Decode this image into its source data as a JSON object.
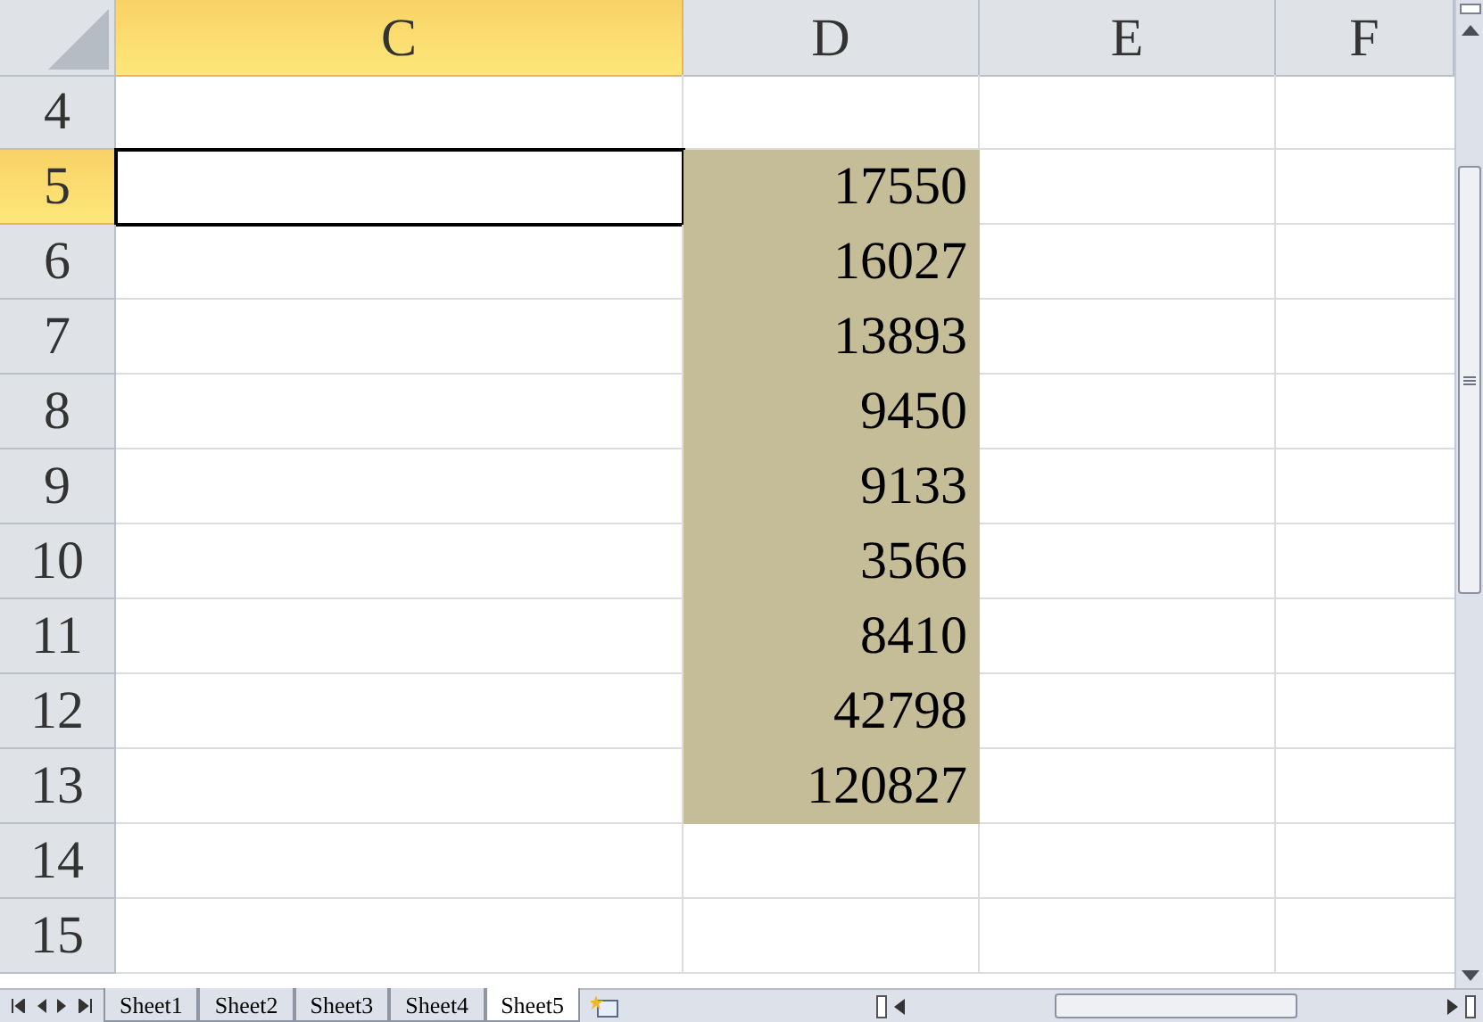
{
  "columns": [
    {
      "label": "C",
      "selected": true
    },
    {
      "label": "D",
      "selected": false
    },
    {
      "label": "E",
      "selected": false
    },
    {
      "label": "F",
      "selected": false
    }
  ],
  "rows": [
    {
      "label": "4",
      "selected": false,
      "cells": [
        {
          "filled": false,
          "active": false
        },
        {
          "filled": false,
          "active": false
        }
      ]
    },
    {
      "label": "5",
      "selected": true,
      "cells": [
        {
          "filled": false,
          "active": true
        },
        {
          "value": "17550",
          "filled": true,
          "active": false
        }
      ]
    },
    {
      "label": "6",
      "selected": false,
      "cells": [
        {
          "filled": false,
          "active": false
        },
        {
          "value": "16027",
          "filled": true,
          "active": false
        }
      ]
    },
    {
      "label": "7",
      "selected": false,
      "cells": [
        {
          "filled": false,
          "active": false
        },
        {
          "value": "13893",
          "filled": true,
          "active": false
        }
      ]
    },
    {
      "label": "8",
      "selected": false,
      "cells": [
        {
          "filled": false,
          "active": false
        },
        {
          "value": "9450",
          "filled": true,
          "active": false
        }
      ]
    },
    {
      "label": "9",
      "selected": false,
      "cells": [
        {
          "filled": false,
          "active": false
        },
        {
          "value": "9133",
          "filled": true,
          "active": false
        }
      ]
    },
    {
      "label": "10",
      "selected": false,
      "cells": [
        {
          "filled": false,
          "active": false
        },
        {
          "value": "3566",
          "filled": true,
          "active": false
        }
      ]
    },
    {
      "label": "11",
      "selected": false,
      "cells": [
        {
          "filled": false,
          "active": false
        },
        {
          "value": "8410",
          "filled": true,
          "active": false
        }
      ]
    },
    {
      "label": "12",
      "selected": false,
      "cells": [
        {
          "filled": false,
          "active": false
        },
        {
          "value": "42798",
          "filled": true,
          "active": false
        }
      ]
    },
    {
      "label": "13",
      "selected": false,
      "cells": [
        {
          "filled": false,
          "active": false
        },
        {
          "value": "120827",
          "filled": true,
          "active": false
        }
      ]
    },
    {
      "label": "14",
      "selected": false,
      "cells": [
        {
          "filled": false,
          "active": false
        },
        {
          "filled": false,
          "active": false
        }
      ]
    },
    {
      "label": "15",
      "selected": false,
      "cells": [
        {
          "filled": false,
          "active": false
        },
        {
          "filled": false,
          "active": false
        }
      ]
    }
  ],
  "sheet_tabs": [
    {
      "label": "Sheet1",
      "selected": false
    },
    {
      "label": "Sheet2",
      "selected": false
    },
    {
      "label": "Sheet3",
      "selected": false
    },
    {
      "label": "Sheet4",
      "selected": false
    },
    {
      "label": "Sheet5",
      "selected": true
    }
  ]
}
